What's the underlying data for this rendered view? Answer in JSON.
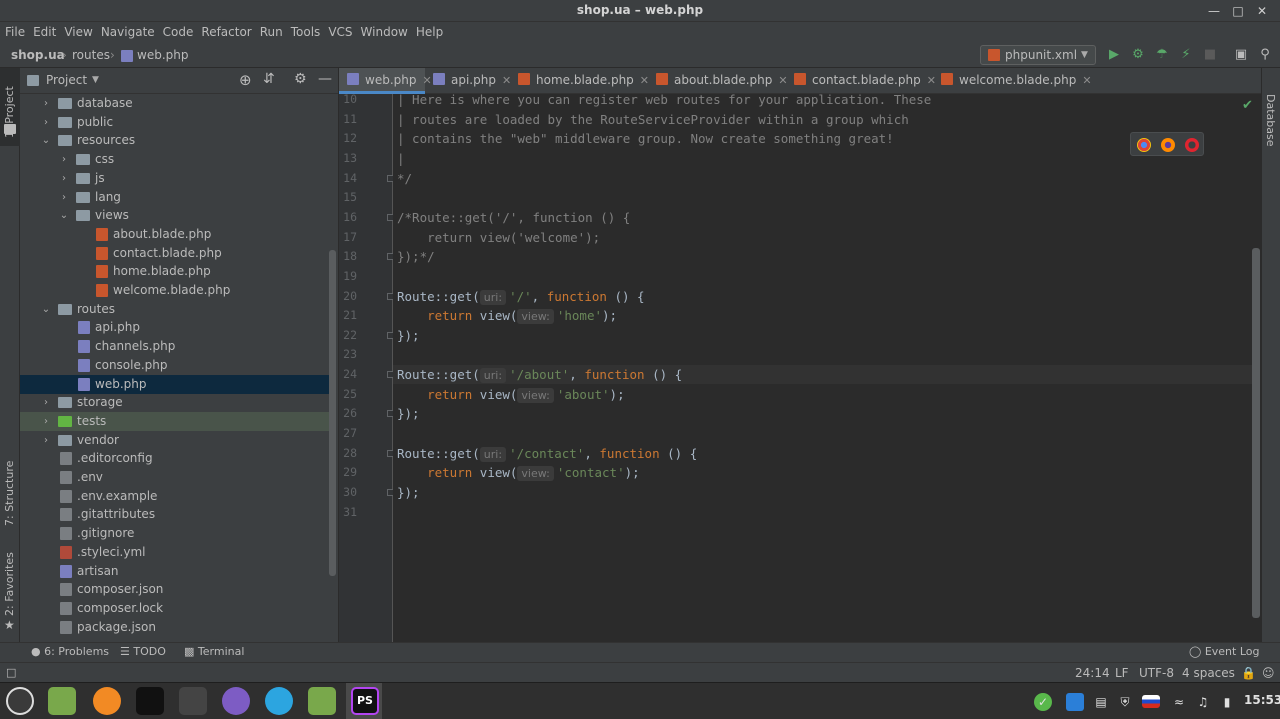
{
  "window": {
    "title": "shop.ua – web.php"
  },
  "menu": [
    "File",
    "Edit",
    "View",
    "Navigate",
    "Code",
    "Refactor",
    "Run",
    "Tools",
    "VCS",
    "Window",
    "Help"
  ],
  "breadcrumb": {
    "project": "shop.ua",
    "folder": "routes",
    "file": "web.php"
  },
  "run_config": "phpunit.xml",
  "project_panel": {
    "title": "Project",
    "tree": [
      {
        "label": "database",
        "type": "folder",
        "depth": 1,
        "expanded": false
      },
      {
        "label": "public",
        "type": "folder",
        "depth": 1,
        "expanded": false
      },
      {
        "label": "resources",
        "type": "folder",
        "depth": 1,
        "expanded": true
      },
      {
        "label": "css",
        "type": "folder",
        "depth": 2,
        "expanded": false
      },
      {
        "label": "js",
        "type": "folder",
        "depth": 2,
        "expanded": false
      },
      {
        "label": "lang",
        "type": "folder",
        "depth": 2,
        "expanded": false
      },
      {
        "label": "views",
        "type": "folder",
        "depth": 2,
        "expanded": true
      },
      {
        "label": "about.blade.php",
        "type": "blade",
        "depth": 3
      },
      {
        "label": "contact.blade.php",
        "type": "blade",
        "depth": 3
      },
      {
        "label": "home.blade.php",
        "type": "blade",
        "depth": 3
      },
      {
        "label": "welcome.blade.php",
        "type": "blade",
        "depth": 3
      },
      {
        "label": "routes",
        "type": "folder",
        "depth": 1,
        "expanded": true
      },
      {
        "label": "api.php",
        "type": "php",
        "depth": 2
      },
      {
        "label": "channels.php",
        "type": "php",
        "depth": 2
      },
      {
        "label": "console.php",
        "type": "php",
        "depth": 2
      },
      {
        "label": "web.php",
        "type": "php",
        "depth": 2,
        "selected": true
      },
      {
        "label": "storage",
        "type": "folder",
        "depth": 1,
        "expanded": false
      },
      {
        "label": "tests",
        "type": "folder-green",
        "depth": 1,
        "expanded": false,
        "highlight": true
      },
      {
        "label": "vendor",
        "type": "folder",
        "depth": 1,
        "expanded": false
      },
      {
        "label": ".editorconfig",
        "type": "gen",
        "depth": 1
      },
      {
        "label": ".env",
        "type": "gen",
        "depth": 1
      },
      {
        "label": ".env.example",
        "type": "gen",
        "depth": 1
      },
      {
        "label": ".gitattributes",
        "type": "gen",
        "depth": 1
      },
      {
        "label": ".gitignore",
        "type": "gen",
        "depth": 1
      },
      {
        "label": ".styleci.yml",
        "type": "yml",
        "depth": 1
      },
      {
        "label": "artisan",
        "type": "php",
        "depth": 1
      },
      {
        "label": "composer.json",
        "type": "gen",
        "depth": 1
      },
      {
        "label": "composer.lock",
        "type": "gen",
        "depth": 1
      },
      {
        "label": "package.json",
        "type": "gen",
        "depth": 1
      }
    ]
  },
  "tabs": [
    {
      "label": "web.php",
      "icon": "php",
      "active": true
    },
    {
      "label": "api.php",
      "icon": "php"
    },
    {
      "label": "home.blade.php",
      "icon": "blade"
    },
    {
      "label": "about.blade.php",
      "icon": "blade"
    },
    {
      "label": "contact.blade.php",
      "icon": "blade"
    },
    {
      "label": "welcome.blade.php",
      "icon": "blade"
    }
  ],
  "left_tool_windows": [
    "1: Project",
    "7: Structure",
    "2: Favorites"
  ],
  "right_tool_windows": [
    "Database"
  ],
  "code": [
    {
      "n": "10",
      "parts": [
        {
          "c": "cm",
          "t": "| Here is where you can register web routes for your application. These"
        }
      ]
    },
    {
      "n": "11",
      "parts": [
        {
          "c": "cm",
          "t": "| routes are loaded by the RouteServiceProvider within a group which"
        }
      ]
    },
    {
      "n": "12",
      "parts": [
        {
          "c": "cm",
          "t": "| contains the \"web\" middleware group. Now create something great!"
        }
      ]
    },
    {
      "n": "13",
      "parts": [
        {
          "c": "cm",
          "t": "|"
        }
      ]
    },
    {
      "n": "14",
      "parts": [
        {
          "c": "cm",
          "t": "*/"
        }
      ]
    },
    {
      "n": "15",
      "parts": []
    },
    {
      "n": "16",
      "parts": [
        {
          "c": "cm",
          "t": "/*Route::get('/', function () {"
        }
      ]
    },
    {
      "n": "17",
      "parts": [
        {
          "c": "cm",
          "t": "    return view('welcome');"
        }
      ]
    },
    {
      "n": "18",
      "parts": [
        {
          "c": "cm",
          "t": "});*/"
        }
      ]
    },
    {
      "n": "19",
      "parts": []
    },
    {
      "n": "20",
      "parts": [
        {
          "c": "",
          "t": "Route::get("
        },
        {
          "c": "hint",
          "t": "uri:"
        },
        {
          "c": "st",
          "t": "'/'"
        },
        {
          "c": "",
          "t": ", "
        },
        {
          "c": "kw",
          "t": "function"
        },
        {
          "c": "",
          "t": " () {"
        }
      ]
    },
    {
      "n": "21",
      "parts": [
        {
          "c": "",
          "t": "    "
        },
        {
          "c": "kw",
          "t": "return"
        },
        {
          "c": "",
          "t": " view("
        },
        {
          "c": "hint",
          "t": "view:"
        },
        {
          "c": "st",
          "t": "'home'"
        },
        {
          "c": "",
          "t": ");"
        }
      ]
    },
    {
      "n": "22",
      "parts": [
        {
          "c": "",
          "t": "});"
        }
      ]
    },
    {
      "n": "23",
      "parts": []
    },
    {
      "n": "24",
      "parts": [
        {
          "c": "",
          "t": "Route::get("
        },
        {
          "c": "hint",
          "t": "uri:"
        },
        {
          "c": "st",
          "t": "'/about'"
        },
        {
          "c": "",
          "t": ", "
        },
        {
          "c": "kw",
          "t": "function"
        },
        {
          "c": "",
          "t": " () {"
        }
      ],
      "current": true
    },
    {
      "n": "25",
      "parts": [
        {
          "c": "",
          "t": "    "
        },
        {
          "c": "kw",
          "t": "return"
        },
        {
          "c": "",
          "t": " view("
        },
        {
          "c": "hint",
          "t": "view:"
        },
        {
          "c": "st",
          "t": "'about'"
        },
        {
          "c": "",
          "t": ");"
        }
      ]
    },
    {
      "n": "26",
      "parts": [
        {
          "c": "",
          "t": "});"
        }
      ]
    },
    {
      "n": "27",
      "parts": []
    },
    {
      "n": "28",
      "parts": [
        {
          "c": "",
          "t": "Route::get("
        },
        {
          "c": "hint",
          "t": "uri:"
        },
        {
          "c": "st",
          "t": "'/contact'"
        },
        {
          "c": "",
          "t": ", "
        },
        {
          "c": "kw",
          "t": "function"
        },
        {
          "c": "",
          "t": " () {"
        }
      ]
    },
    {
      "n": "29",
      "parts": [
        {
          "c": "",
          "t": "    "
        },
        {
          "c": "kw",
          "t": "return"
        },
        {
          "c": "",
          "t": " view("
        },
        {
          "c": "hint",
          "t": "view:"
        },
        {
          "c": "st",
          "t": "'contact'"
        },
        {
          "c": "",
          "t": ");"
        }
      ]
    },
    {
      "n": "30",
      "parts": [
        {
          "c": "",
          "t": "});"
        }
      ]
    },
    {
      "n": "31",
      "parts": []
    }
  ],
  "bottom_tools": {
    "problems": "6: Problems",
    "todo": "TODO",
    "terminal": "Terminal",
    "event_log": "Event Log"
  },
  "status": {
    "position": "24:14",
    "line_sep": "LF",
    "encoding": "UTF-8",
    "indent": "4 spaces"
  },
  "taskbar": {
    "clock": "15:53",
    "active_app_label": "PS"
  },
  "colors": {
    "accent": "#4a88c7",
    "selection": "#0d293e",
    "keyword": "#cc7832",
    "string": "#6a8759",
    "comment": "#808080"
  }
}
